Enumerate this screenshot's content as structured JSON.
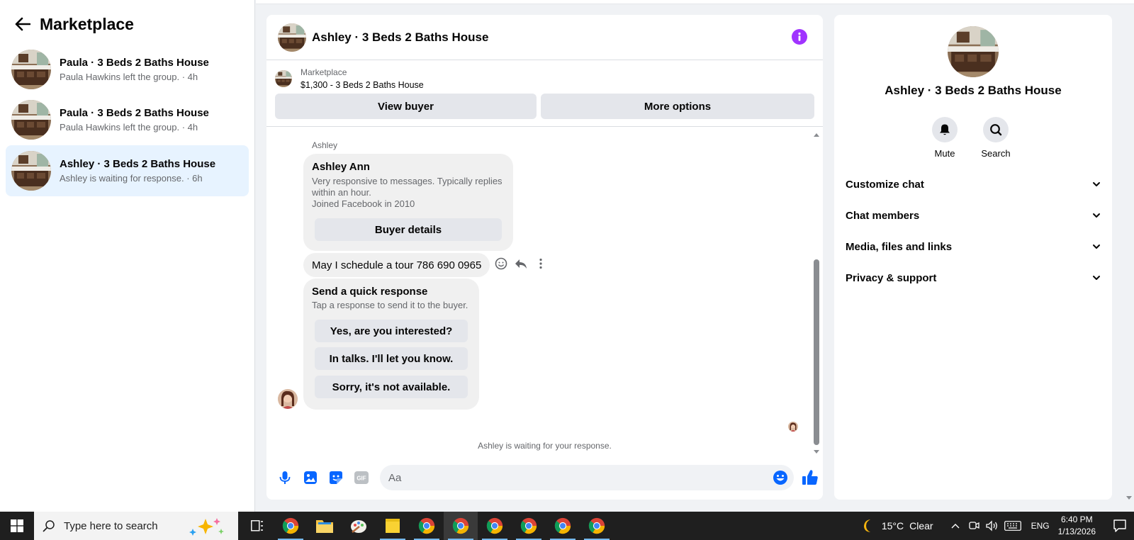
{
  "sidebar": {
    "title": "Marketplace",
    "conversations": [
      {
        "title": "Paula · 3 Beds 2 Baths House",
        "subtitle": "Paula Hawkins left the group. · 4h"
      },
      {
        "title": "Paula · 3 Beds 2 Baths House",
        "subtitle": "Paula Hawkins left the group. · 4h"
      },
      {
        "title": "Ashley · 3 Beds 2 Baths House",
        "subtitle": "Ashley is waiting for response. · 6h"
      }
    ]
  },
  "chat": {
    "title": "Ashley · 3 Beds 2 Baths House",
    "listing": {
      "category": "Marketplace",
      "price_title": "$1,300 - 3 Beds 2 Baths House",
      "view_buyer_label": "View buyer",
      "more_options_label": "More options"
    },
    "messages": {
      "sender_label": "Ashley",
      "buyer_card": {
        "name": "Ashley Ann",
        "line1": "Very responsive to messages. Typically replies",
        "line2": "within an hour.",
        "line3": "Joined Facebook in 2010",
        "button_label": "Buyer details"
      },
      "text_message": "May I schedule a tour 786 690 0965",
      "quick_response": {
        "title": "Send a quick response",
        "subtitle": "Tap a response to send it to the buyer.",
        "options": [
          "Yes, are you interested?",
          "In talks. I'll let you know.",
          "Sorry, it's not available."
        ]
      },
      "waiting_note": "Ashley is waiting for your response."
    },
    "composer": {
      "placeholder": "Aa"
    }
  },
  "details": {
    "title": "Ashley · 3 Beds 2 Baths House",
    "actions": {
      "mute_label": "Mute",
      "search_label": "Search"
    },
    "sections": [
      "Customize chat",
      "Chat members",
      "Media, files and links",
      "Privacy & support"
    ]
  },
  "taskbar": {
    "search_placeholder": "Type here to search",
    "weather": {
      "temp": "15°C",
      "condition": "Clear"
    },
    "language": "ENG",
    "time": "6:40 PM",
    "date": "1/13/2026"
  },
  "colors": {
    "accent": "#0866ff",
    "info": "#a033ff",
    "selected_conversation": "#e7f3ff"
  }
}
